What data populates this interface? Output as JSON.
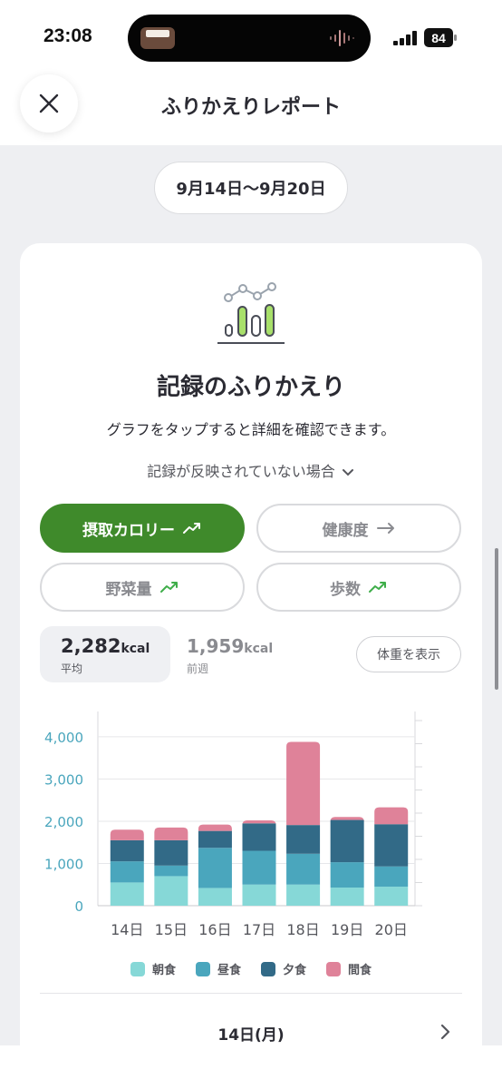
{
  "status_bar": {
    "time": "23:08",
    "battery": "84"
  },
  "header": {
    "title": "ふりかえりレポート"
  },
  "date_range": "9月14日〜9月20日",
  "card": {
    "title": "記録のふりかえり",
    "description": "グラフをタップすると詳細を確認できます。",
    "toggle_text": "記録が反映されていない場合"
  },
  "metrics": [
    {
      "label": "摂取カロリー",
      "trend": "up",
      "active": true
    },
    {
      "label": "健康度",
      "trend": "flat",
      "active": false
    },
    {
      "label": "野菜量",
      "trend": "up",
      "active": false
    },
    {
      "label": "歩数",
      "trend": "up",
      "active": false
    }
  ],
  "summary": {
    "average_value": "2,282",
    "average_unit": "kcal",
    "average_label": "平均",
    "previous_value": "1,959",
    "previous_unit": "kcal",
    "previous_label": "前週",
    "weight_button": "体重を表示"
  },
  "colors": {
    "accent_green": "#3f8a2b",
    "breakfast": "#86d8d7",
    "lunch": "#4aa6bd",
    "dinner": "#326a87",
    "snack": "#df8299"
  },
  "chart_data": {
    "type": "bar",
    "stacked": true,
    "categories": [
      "14日",
      "15日",
      "16日",
      "17日",
      "18日",
      "19日",
      "20日"
    ],
    "series": [
      {
        "name": "朝食",
        "values": [
          550,
          700,
          420,
          500,
          500,
          430,
          450
        ]
      },
      {
        "name": "昼食",
        "values": [
          500,
          250,
          950,
          800,
          730,
          600,
          480
        ]
      },
      {
        "name": "夕食",
        "values": [
          500,
          600,
          400,
          650,
          680,
          1000,
          1000
        ]
      },
      {
        "name": "間食",
        "values": [
          250,
          300,
          150,
          70,
          1970,
          70,
          400
        ]
      }
    ],
    "y_ticks": [
      "0",
      "1,000",
      "2,000",
      "3,000",
      "4,000"
    ],
    "ylim": [
      0,
      4600
    ],
    "grid": true,
    "legend_position": "bottom"
  },
  "day_detail": {
    "label": "14日(月)"
  }
}
